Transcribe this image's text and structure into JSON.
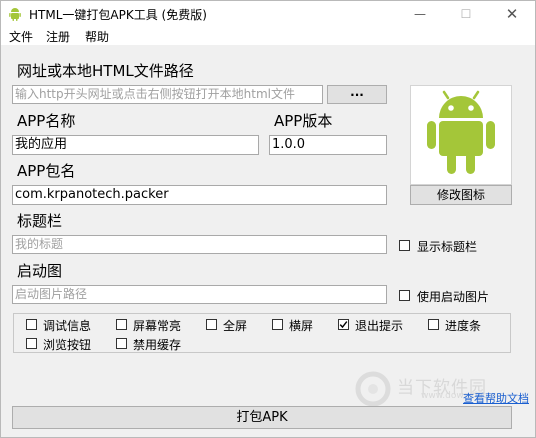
{
  "window": {
    "title": "HTML一键打包APK工具 (免费版)",
    "controls": {
      "minimize": "—",
      "maximize": "☐",
      "close": "✕"
    },
    "app_icon": "android-icon"
  },
  "menu": {
    "items": [
      "文件",
      "注册",
      "帮助"
    ]
  },
  "form": {
    "url_label": "网址或本地HTML文件路径",
    "url_placeholder": "输入http开头网址或点击右侧按钮打开本地html文件",
    "browse_label": "...",
    "app_name_label": "APP名称",
    "app_name_value": "我的应用",
    "app_version_label": "APP版本",
    "app_version_value": "1.0.0",
    "package_label": "APP包名",
    "package_value": "com.krpanotech.packer",
    "titlebar_label": "标题栏",
    "titlebar_placeholder": "我的标题",
    "show_titlebar_label": "显示标题栏",
    "splash_label": "启动图",
    "splash_placeholder": "启动图片路径",
    "use_splash_label": "使用启动图片",
    "change_icon_label": "修改图标"
  },
  "options": [
    {
      "label": "调试信息",
      "checked": false
    },
    {
      "label": "屏幕常亮",
      "checked": false
    },
    {
      "label": "全屏",
      "checked": false
    },
    {
      "label": "横屏",
      "checked": false
    },
    {
      "label": "退出提示",
      "checked": true
    },
    {
      "label": "进度条",
      "checked": false
    },
    {
      "label": "浏览按钮",
      "checked": false
    },
    {
      "label": "禁用缓存",
      "checked": false
    }
  ],
  "footer": {
    "doc_link": "查看帮助文档",
    "pack_label": "打包APK",
    "watermark_text": "当下软件园",
    "watermark_sub": "www.downxia.com"
  },
  "colors": {
    "android_green": "#a4c639",
    "link_blue": "#1a5fd0"
  }
}
